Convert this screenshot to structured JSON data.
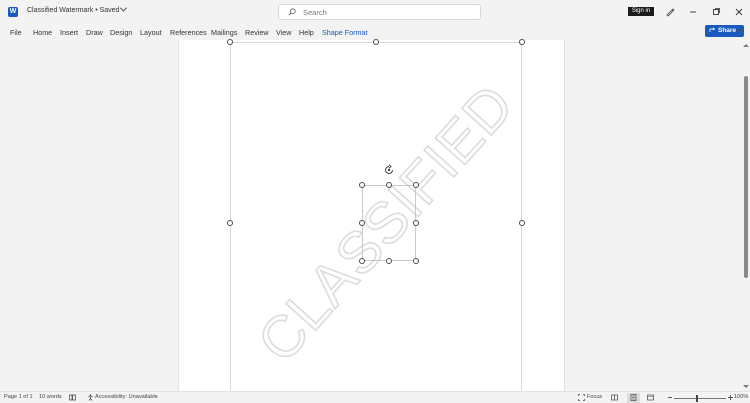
{
  "window": {
    "doc_title": "Classified Watermark • Saved",
    "search_placeholder": "Search",
    "sign_in": "Sign in",
    "share": "Share"
  },
  "menu": {
    "items": [
      "File",
      "Home",
      "Insert",
      "Draw",
      "Design",
      "Layout",
      "References",
      "Mailings",
      "Review",
      "View",
      "Help",
      "Shape Format"
    ],
    "active": "Shape Format"
  },
  "document": {
    "watermark_text": "CLASSIFIED",
    "watermark_color": "#e6e6e6"
  },
  "status": {
    "page": "Page 1 of 1",
    "words": "10 words",
    "accessibility": "Accessibility: Unavailable",
    "focus": "Focus",
    "zoom": "100%"
  },
  "colors": {
    "accent": "#185abd",
    "sign_in_bg": "#1b1b1b"
  },
  "icons": [
    "word-app-icon",
    "chevron-down-icon",
    "search-icon",
    "pen-icon",
    "minimize-icon",
    "maximize-icon",
    "close-icon",
    "share-icon",
    "rotate-handle-icon",
    "proofing-icon",
    "accessibility-icon",
    "focus-icon",
    "read-mode-icon",
    "print-layout-icon",
    "web-layout-icon"
  ]
}
